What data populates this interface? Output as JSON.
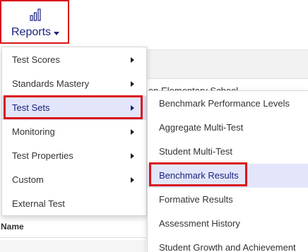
{
  "nav": {
    "reports_label": "Reports",
    "icon": "bar-chart-icon",
    "caret_icon": "caret-down-icon"
  },
  "background": {
    "school_name": "on Elementary School",
    "table_header_name": "Name"
  },
  "menu": {
    "items": [
      {
        "label": "Test Scores",
        "has_submenu": true,
        "active": false
      },
      {
        "label": "Standards Mastery",
        "has_submenu": true,
        "active": false
      },
      {
        "label": "Test Sets",
        "has_submenu": true,
        "active": true
      },
      {
        "label": "Monitoring",
        "has_submenu": true,
        "active": false
      },
      {
        "label": "Test Properties",
        "has_submenu": true,
        "active": false
      },
      {
        "label": "Custom",
        "has_submenu": true,
        "active": false
      },
      {
        "label": "External Test",
        "has_submenu": false,
        "active": false
      }
    ]
  },
  "submenu": {
    "parent": "Test Sets",
    "items": [
      {
        "label": "Benchmark Performance Levels",
        "active": false
      },
      {
        "label": "Aggregate Multi-Test",
        "active": false
      },
      {
        "label": "Student Multi-Test",
        "active": false
      },
      {
        "label": "Benchmark Results",
        "active": true
      },
      {
        "label": "Formative Results",
        "active": false
      },
      {
        "label": "Assessment History",
        "active": false
      },
      {
        "label": "Student Growth and Achievement",
        "active": false
      }
    ]
  },
  "colors": {
    "accent_nav": "#1a237e",
    "highlight_border": "#d9161c",
    "active_bg": "#e3e6fa"
  }
}
